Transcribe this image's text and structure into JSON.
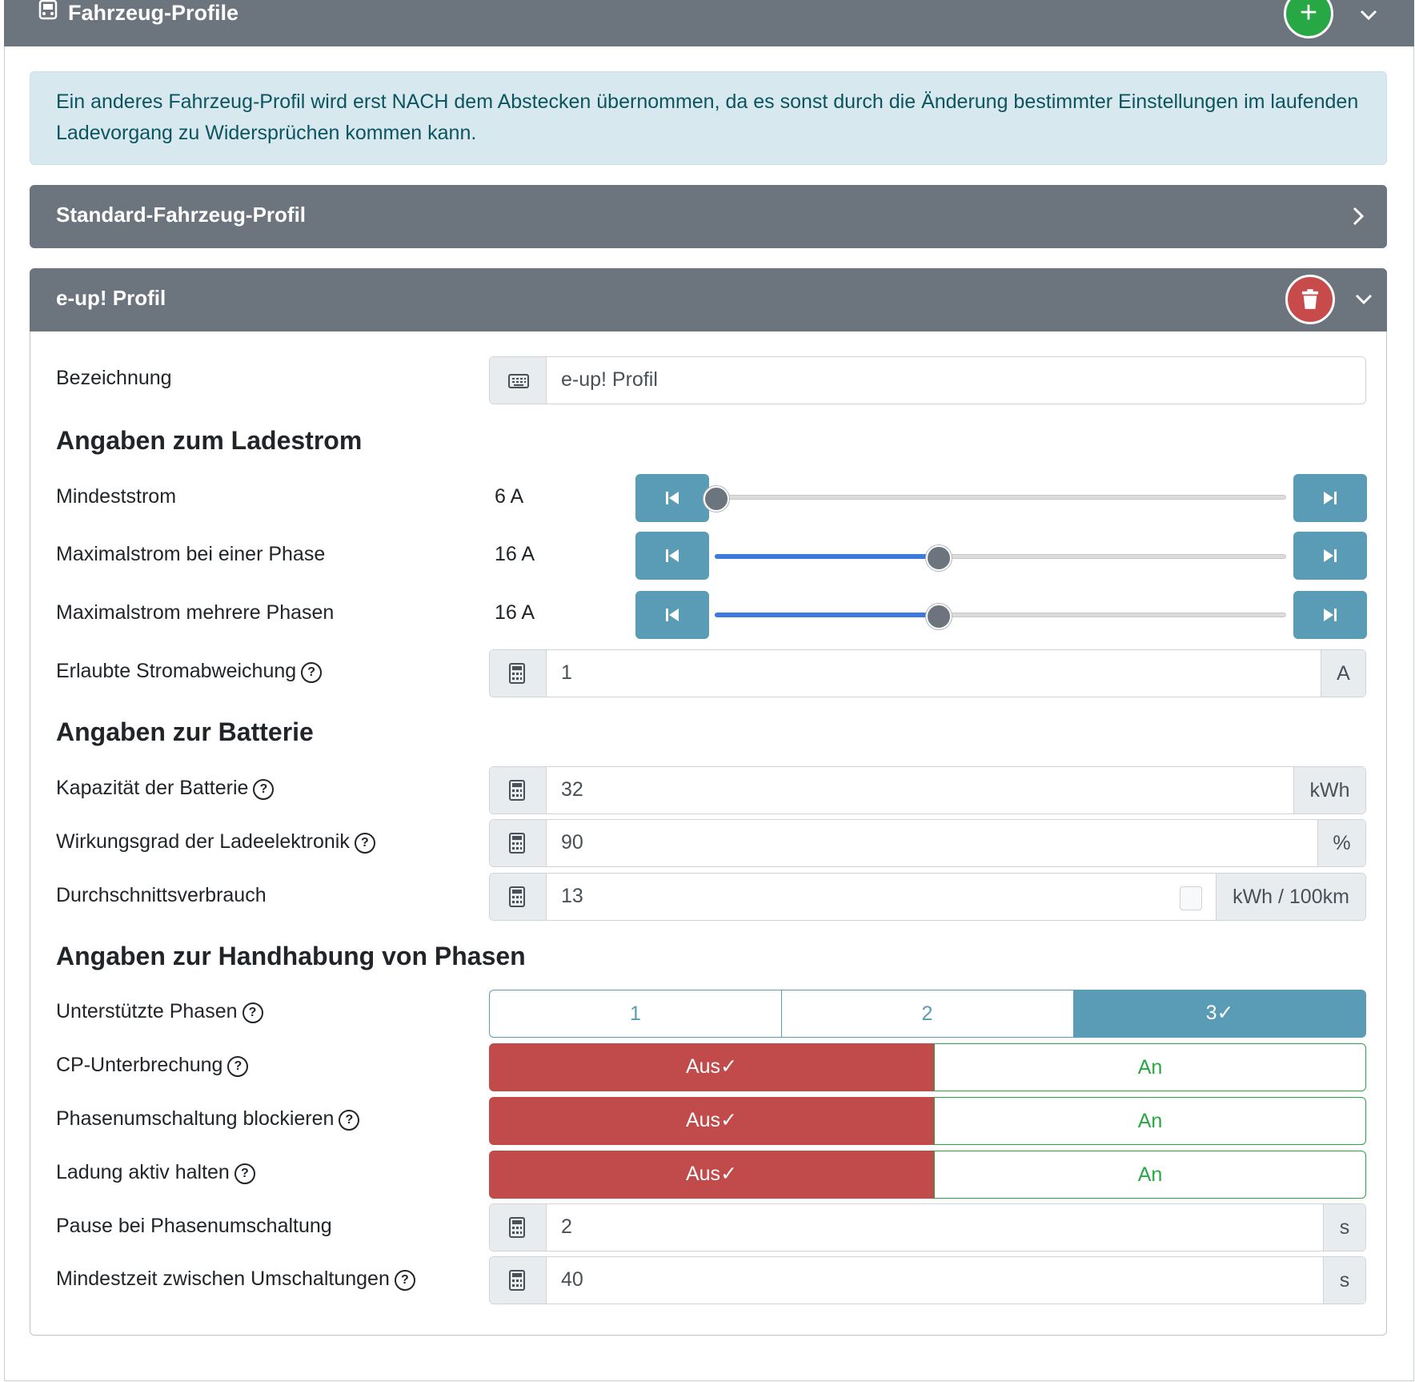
{
  "header": {
    "title": "Fahrzeug-Profile",
    "add_label": "+"
  },
  "alert": {
    "text": "Ein anderes Fahrzeug-Profil wird erst NACH dem Abstecken übernommen, da es sonst durch die Änderung bestimmter Einstellungen im laufenden Ladevorgang zu Widersprüchen kommen kann."
  },
  "profiles": [
    {
      "title": "Standard-Fahrzeug-Profil"
    },
    {
      "title": "e-up! Profil"
    }
  ],
  "form": {
    "name_label": "Bezeichnung",
    "name_value": "e-up! Profil",
    "section_current": "Angaben zum Ladestrom",
    "min_current_label": "Mindeststrom",
    "min_current_value": "6 A",
    "min_current_fraction": 0.0,
    "max_one_label": "Maximalstrom bei einer Phase",
    "max_one_value": "16 A",
    "max_one_fraction": 0.39,
    "max_multi_label": "Maximalstrom mehrere Phasen",
    "max_multi_value": "16 A",
    "max_multi_fraction": 0.39,
    "deviation_label": "Erlaubte Stromabweichung",
    "deviation_value": "1",
    "deviation_unit": "A",
    "section_battery": "Angaben zur Batterie",
    "capacity_label": "Kapazität der Batterie",
    "capacity_value": "32",
    "capacity_unit": "kWh",
    "efficiency_label": "Wirkungsgrad der Ladeelektronik",
    "efficiency_value": "90",
    "efficiency_unit": "%",
    "consumption_label": "Durchschnittsverbrauch",
    "consumption_value": "13",
    "consumption_unit": "kWh / 100km",
    "section_phases": "Angaben zur Handhabung von Phasen",
    "phases_label": "Unterstützte Phasen",
    "phase_options": [
      "1",
      "2",
      "3"
    ],
    "phase_selected": "3",
    "cp_label": "CP-Unterbrechung",
    "block_label": "Phasenumschaltung blockieren",
    "keep_label": "Ladung aktiv halten",
    "off_label": "Aus",
    "on_label": "An",
    "pause_label": "Pause bei Phasenumschaltung",
    "pause_value": "2",
    "pause_unit": "s",
    "min_time_label": "Mindestzeit zwischen Umschaltungen",
    "min_time_value": "40",
    "min_time_unit": "s"
  },
  "colors": {
    "header": "#6c757d",
    "accent": "#5a9bb5",
    "danger": "#c84b4b",
    "success": "#28a745"
  }
}
